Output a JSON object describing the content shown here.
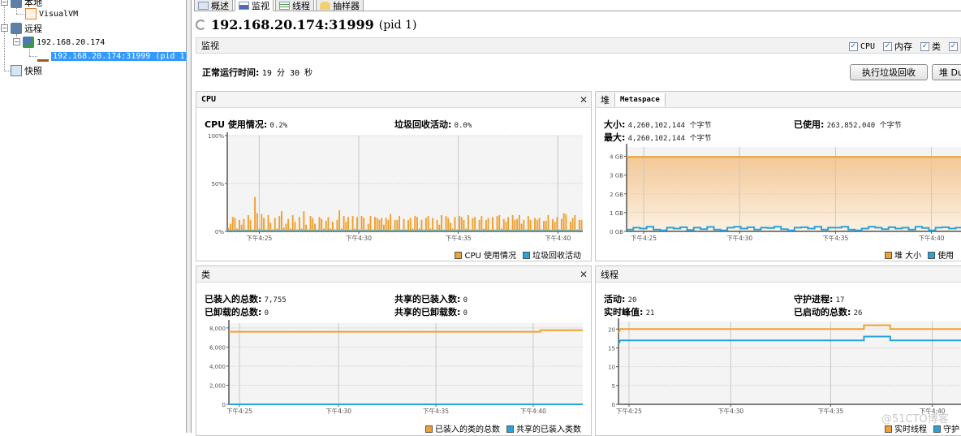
{
  "tree": {
    "local": "本地",
    "visualvm": "VisualVM",
    "remote": "远程",
    "host": "192.168.20.174",
    "process": "192.168.20.174:31999 (pid 1)",
    "snapshots": "快照"
  },
  "tabs": [
    {
      "label": "概述",
      "icon": "overview-icon"
    },
    {
      "label": "监视",
      "icon": "monitor-icon",
      "active": true
    },
    {
      "label": "线程",
      "icon": "threads-icon"
    },
    {
      "label": "抽样器",
      "icon": "sampler-icon"
    }
  ],
  "header": {
    "title": "192.168.20.174:31999",
    "pid": "(pid 1)",
    "section": "监视",
    "checkboxes": [
      {
        "label": "CPU",
        "checked": true
      },
      {
        "label": "内存",
        "checked": true
      },
      {
        "label": "类",
        "checked": true
      },
      {
        "label": "",
        "checked": true
      }
    ],
    "uptime_label": "正常运行时间:",
    "uptime_value": "19 分 30 秒",
    "gc_button": "执行垃圾回收",
    "heapdump_button": "堆 Du"
  },
  "cpu_panel": {
    "title": "CPU",
    "usage_label": "CPU 使用情况:",
    "usage_value": "0.2%",
    "gc_label": "垃圾回收活动:",
    "gc_value": "0.0%",
    "legend": [
      "CPU 使用情况",
      "垃圾回收活动"
    ]
  },
  "heap_panel": {
    "tabs": [
      "堆",
      "Metaspace"
    ],
    "size_label": "大小:",
    "size_value": "4,260,102,144 个字节",
    "max_label": "最大:",
    "max_value": "4,260,102,144 个字节",
    "used_label": "已使用:",
    "used_value": "263,852,040 个字节",
    "legend": [
      "堆 大小",
      "使用"
    ]
  },
  "classes_panel": {
    "title": "类",
    "loaded_label": "已装入的总数:",
    "loaded_value": "7,755",
    "unloaded_label": "已卸载的总数:",
    "unloaded_value": "0",
    "shared_loaded_label": "共享的已装入数:",
    "shared_loaded_value": "0",
    "shared_unloaded_label": "共享的已卸载数:",
    "shared_unloaded_value": "0",
    "legend": [
      "已装入的类的总数",
      "共享的已装入类数"
    ]
  },
  "threads_panel": {
    "title": "线程",
    "live_label": "活动:",
    "live_value": "20",
    "peak_label": "实时峰值:",
    "peak_value": "21",
    "daemon_label": "守护进程:",
    "daemon_value": "17",
    "started_label": "已启动的总数:",
    "started_value": "26",
    "legend": [
      "实时线程",
      "守护"
    ]
  },
  "watermark": "@51CTO博客",
  "colors": {
    "orange": "#f0a030",
    "blue": "#29a3d8",
    "selection": "#3399ff"
  },
  "chart_data": [
    {
      "type": "bar",
      "title": "CPU",
      "x_ticks": [
        "下午4:25",
        "下午4:30",
        "下午4:35",
        "下午4:40"
      ],
      "y_ticks": [
        "0%",
        "50%",
        "100%"
      ],
      "ylim": [
        0,
        100
      ],
      "series": [
        {
          "name": "CPU 使用情况",
          "color": "#f0a030",
          "values": [
            4,
            8,
            15,
            14,
            3,
            12,
            7,
            13,
            2,
            17,
            12,
            2,
            36,
            19,
            3,
            18,
            14,
            2,
            17,
            9,
            2,
            14,
            3,
            16,
            21,
            4,
            8,
            13,
            3,
            17,
            10,
            2,
            15,
            3,
            21,
            7,
            2,
            16,
            14,
            8,
            2,
            15,
            13,
            3,
            11,
            15,
            3,
            10,
            2,
            12,
            22,
            3,
            16,
            10,
            15,
            2,
            16,
            3,
            15,
            2,
            16,
            14,
            2,
            8,
            16,
            2,
            15,
            14,
            12,
            14,
            7,
            14,
            12,
            18,
            2,
            12,
            12,
            16,
            2,
            13,
            2,
            12,
            14,
            3,
            16,
            15,
            3,
            12,
            2,
            14,
            16,
            3,
            14,
            2,
            12,
            7,
            17,
            2,
            16,
            14,
            9,
            3,
            15,
            2,
            16,
            15,
            12,
            3,
            17,
            2,
            14,
            15,
            2,
            12,
            16,
            3,
            12,
            14,
            2,
            15,
            2,
            16,
            17,
            3,
            13,
            10,
            15,
            2,
            17,
            12,
            13,
            17,
            8,
            12,
            2,
            16,
            12,
            2,
            14,
            12,
            14,
            2,
            11,
            11,
            17,
            2,
            13,
            10,
            15,
            2,
            13,
            19,
            18,
            2,
            10,
            14,
            17,
            2,
            12,
            12
          ]
        },
        {
          "name": "垃圾回收活动",
          "color": "#29a3d8",
          "values": [
            0
          ]
        }
      ]
    },
    {
      "type": "area",
      "title": "堆",
      "x_ticks": [
        "下午4:25",
        "下午4:30",
        "下午4:35",
        "下午4:40"
      ],
      "y_ticks": [
        "0 GB",
        "1 GB",
        "2 GB",
        "3 GB",
        "4 GB"
      ],
      "ylim": [
        0,
        4.5
      ],
      "series": [
        {
          "name": "堆 大小",
          "color": "#f0a030",
          "values_gb": [
            3.97
          ]
        },
        {
          "name": "使用",
          "color": "#29a3d8",
          "values_gb": [
            0.1,
            0.2,
            0.15,
            0.25,
            0.1,
            0.05,
            0.2,
            0.15,
            0.22,
            0.08,
            0.2,
            0.12,
            0.24,
            0.1,
            0.05,
            0.2,
            0.25,
            0.15,
            0.22,
            0.1,
            0.2,
            0.18,
            0.25,
            0.12,
            0.05,
            0.2,
            0.22,
            0.15,
            0.25,
            0.1,
            0.2,
            0.2,
            0.25,
            0.1,
            0.05,
            0.15,
            0.25,
            0.2,
            0.12,
            0.22,
            0.15,
            0.2,
            0.1,
            0.25,
            0.18,
            0.05,
            0.2,
            0.22,
            0.15,
            0.2,
            0.25,
            0.1
          ]
        }
      ]
    },
    {
      "type": "line",
      "title": "类",
      "x_ticks": [
        "下午4:25",
        "下午4:30",
        "下午4:35",
        "下午4:40"
      ],
      "y_ticks": [
        "0",
        "2,000",
        "4,000",
        "6,000",
        "8,000"
      ],
      "ylim": [
        0,
        8500
      ],
      "series": [
        {
          "name": "已装入的类的总数",
          "color": "#f0a030",
          "points": [
            [
              0,
              7600
            ],
            [
              0.88,
              7600
            ],
            [
              0.88,
              7755
            ],
            [
              1,
              7755
            ]
          ]
        },
        {
          "name": "共享的已装入类数",
          "color": "#29a3d8",
          "points": [
            [
              0,
              0
            ],
            [
              1,
              0
            ]
          ]
        }
      ]
    },
    {
      "type": "line",
      "title": "线程",
      "x_ticks": [
        "下午4:25",
        "下午4:30",
        "下午4:35",
        "下午4:40"
      ],
      "y_ticks": [
        "0",
        "5",
        "10",
        "15",
        "20"
      ],
      "ylim": [
        0,
        22
      ],
      "series": [
        {
          "name": "实时线程",
          "color": "#f0a030",
          "points": [
            [
              0,
              19
            ],
            [
              0.005,
              20
            ],
            [
              0.7,
              20
            ],
            [
              0.7,
              21
            ],
            [
              0.775,
              21
            ],
            [
              0.775,
              20
            ],
            [
              1,
              20
            ]
          ]
        },
        {
          "name": "守护",
          "color": "#29a3d8",
          "points": [
            [
              0,
              16
            ],
            [
              0.005,
              17
            ],
            [
              0.7,
              17
            ],
            [
              0.7,
              18
            ],
            [
              0.775,
              18
            ],
            [
              0.775,
              17
            ],
            [
              1,
              17
            ]
          ]
        }
      ]
    }
  ]
}
